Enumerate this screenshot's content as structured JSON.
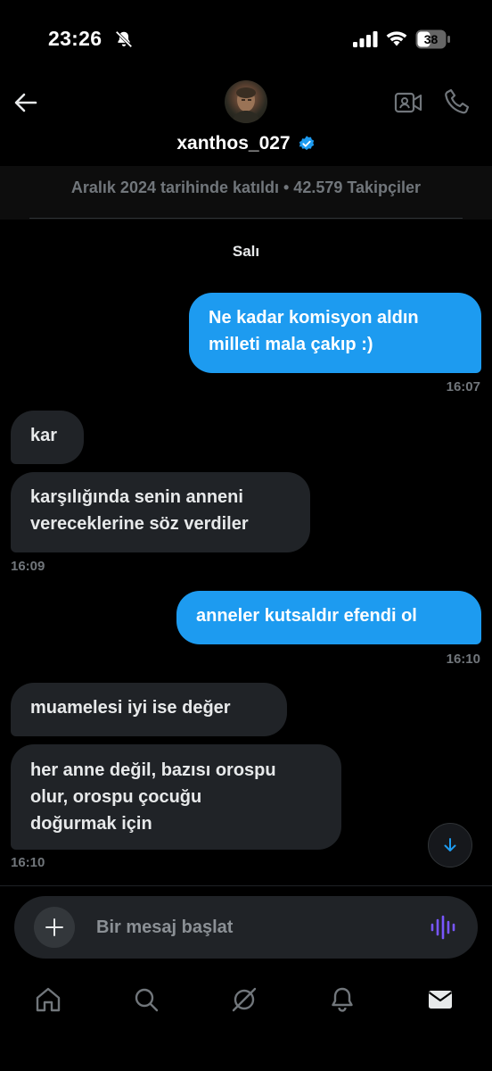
{
  "status_bar": {
    "time": "23:26",
    "battery": "38"
  },
  "header": {
    "username": "xanthos_027",
    "joined": "Aralık 2024 tarihinde katıldı • 42.579 Takipçiler"
  },
  "day_label": "Salı",
  "messages": [
    {
      "side": "sent",
      "lines": [
        "Ne kadar komisyon aldın",
        "milleti mala çakıp :)"
      ],
      "time": "16:07"
    },
    {
      "side": "recv",
      "lines": [
        "kar"
      ]
    },
    {
      "side": "recv",
      "lines": [
        "karşılığında senin anneni",
        "vereceklerine söz verdiler"
      ],
      "time": "16:09"
    },
    {
      "side": "sent",
      "lines": [
        "anneler kutsaldır efendi ol"
      ],
      "time": "16:10"
    },
    {
      "side": "recv",
      "lines": [
        "muamelesi iyi ise değer"
      ]
    },
    {
      "side": "recv",
      "lines": [
        "her anne değil, bazısı orospu",
        "olur, orospu çocuğu",
        "doğurmak için"
      ],
      "time": "16:10"
    }
  ],
  "composer": {
    "placeholder": "Bir mesaj başlat"
  },
  "icons": {
    "back": "arrow-left-icon",
    "video": "video-call-icon",
    "call": "phone-icon",
    "verified": "verified-badge-icon",
    "plus": "plus-icon",
    "voice": "voice-wave-icon",
    "scroll": "arrow-down-icon",
    "nav": [
      "home-icon",
      "search-icon",
      "grok-icon",
      "bell-icon",
      "mail-icon"
    ]
  },
  "colors": {
    "accent": "#1d9bf0",
    "received_bubble": "#202327",
    "voice": "#7856ff"
  }
}
